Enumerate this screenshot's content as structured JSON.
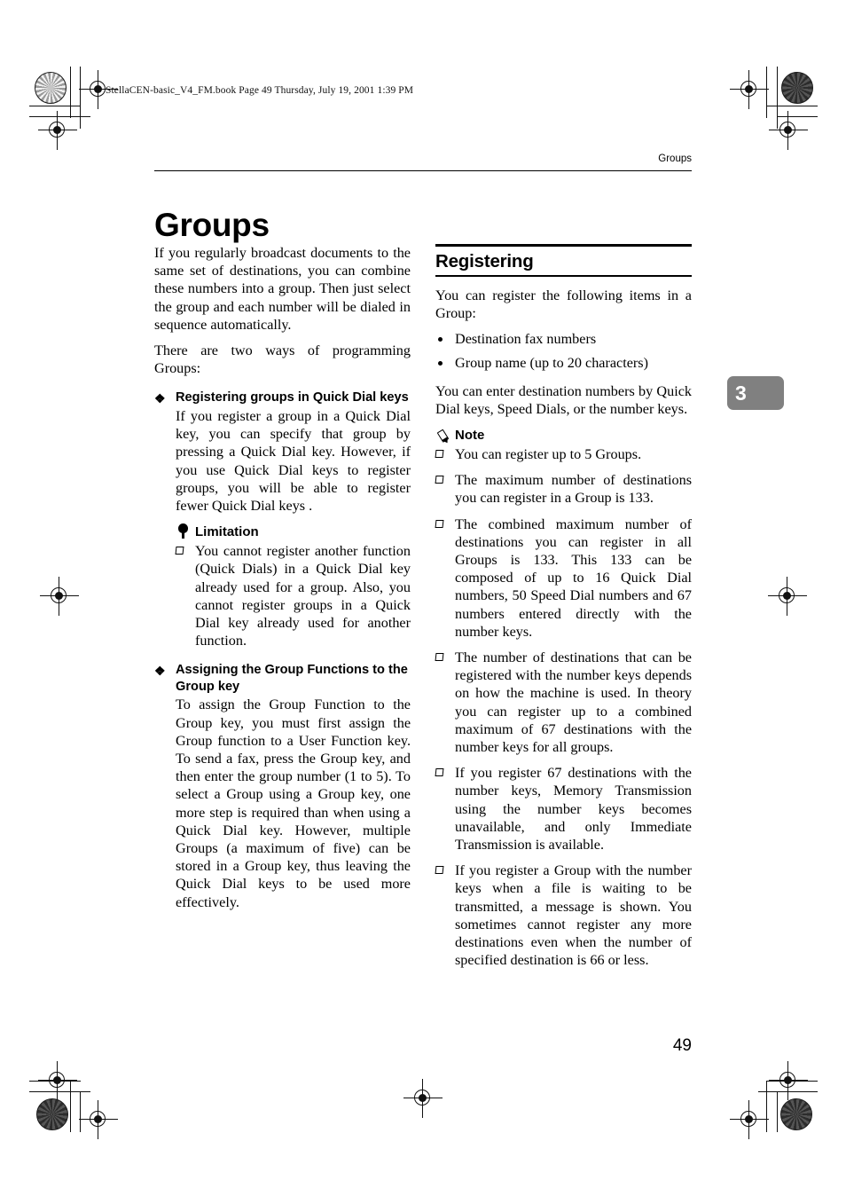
{
  "print_slug": "StellaCEN-basic_V4_FM.book  Page 49  Thursday, July 19, 2001  1:39 PM",
  "running_head": "Groups",
  "page_title": "Groups",
  "chapter_tab": "3",
  "folio": "49",
  "colors": {
    "chapter_tab_bg": "#808080",
    "chapter_tab_text": "#ffffff",
    "rule": "#000000",
    "text": "#000000"
  },
  "left_column": {
    "intro_paragraph": "If you regularly broadcast documents to the same set of destinations, you can combine these numbers into a group. Then just select the group and each number will be dialed in sequence automatically.",
    "intro_paragraph_2": "There are two ways of programming Groups:",
    "sections": [
      {
        "bullet": "❖",
        "heading": "Registering groups in Quick Dial keys",
        "body": "If you register a group in a Quick Dial key, you can specify that group by pressing a Quick Dial key. However, if you use Quick Dial keys to register groups, you will be able to register fewer Quick Dial keys ."
      },
      {
        "bullet": "❖",
        "heading": "Assigning the Group Functions to the Group key",
        "body": "To assign the Group Function to the Group key, you must first assign the Group function to a User Function key. To send a fax, press the Group key, and then enter the group number (1 to 5). To select a Group using a Group key, one more step is required than when using a Quick Dial key. However, multiple Groups (a maximum of five) can be stored in a Group key, thus leaving the Quick Dial keys to be used more effectively."
      }
    ],
    "limitation": {
      "label": "Limitation",
      "icon": "bulb-icon",
      "items": [
        "You cannot register another function (Quick Dials) in a Quick Dial key already used for a group.  Also, you cannot register groups in a Quick Dial key already used for another function."
      ]
    }
  },
  "right_column": {
    "section_heading": "Registering",
    "intro": "You can register the following items in a Group:",
    "bullets": [
      "Destination fax numbers",
      "Group name (up to 20 characters)"
    ],
    "paragraph": "You can enter destination numbers by Quick Dial keys, Speed Dials, or the number keys.",
    "note": {
      "label": "Note",
      "icon": "pencil-icon",
      "items": [
        "You can register up to 5 Groups.",
        "The maximum number of destinations you can register in a Group is 133.",
        "The combined maximum number of destinations you can register in all Groups is 133. This 133 can be composed of up to 16 Quick Dial numbers, 50 Speed Dial numbers and 67 numbers entered directly with the number keys.",
        "The number of destinations that can be registered with the number keys depends on how the machine is used. In theory you can register up to a combined maximum of 67 destinations with the number keys for all groups.",
        "If you register 67 destinations with the number keys, Memory Transmission using the number keys becomes unavailable, and only Immediate Transmission is available.",
        "If you register a Group with the number keys when a file is waiting to be transmitted, a message is shown. You sometimes cannot register any more destinations even when the number of specified destination is 66 or less."
      ]
    }
  }
}
